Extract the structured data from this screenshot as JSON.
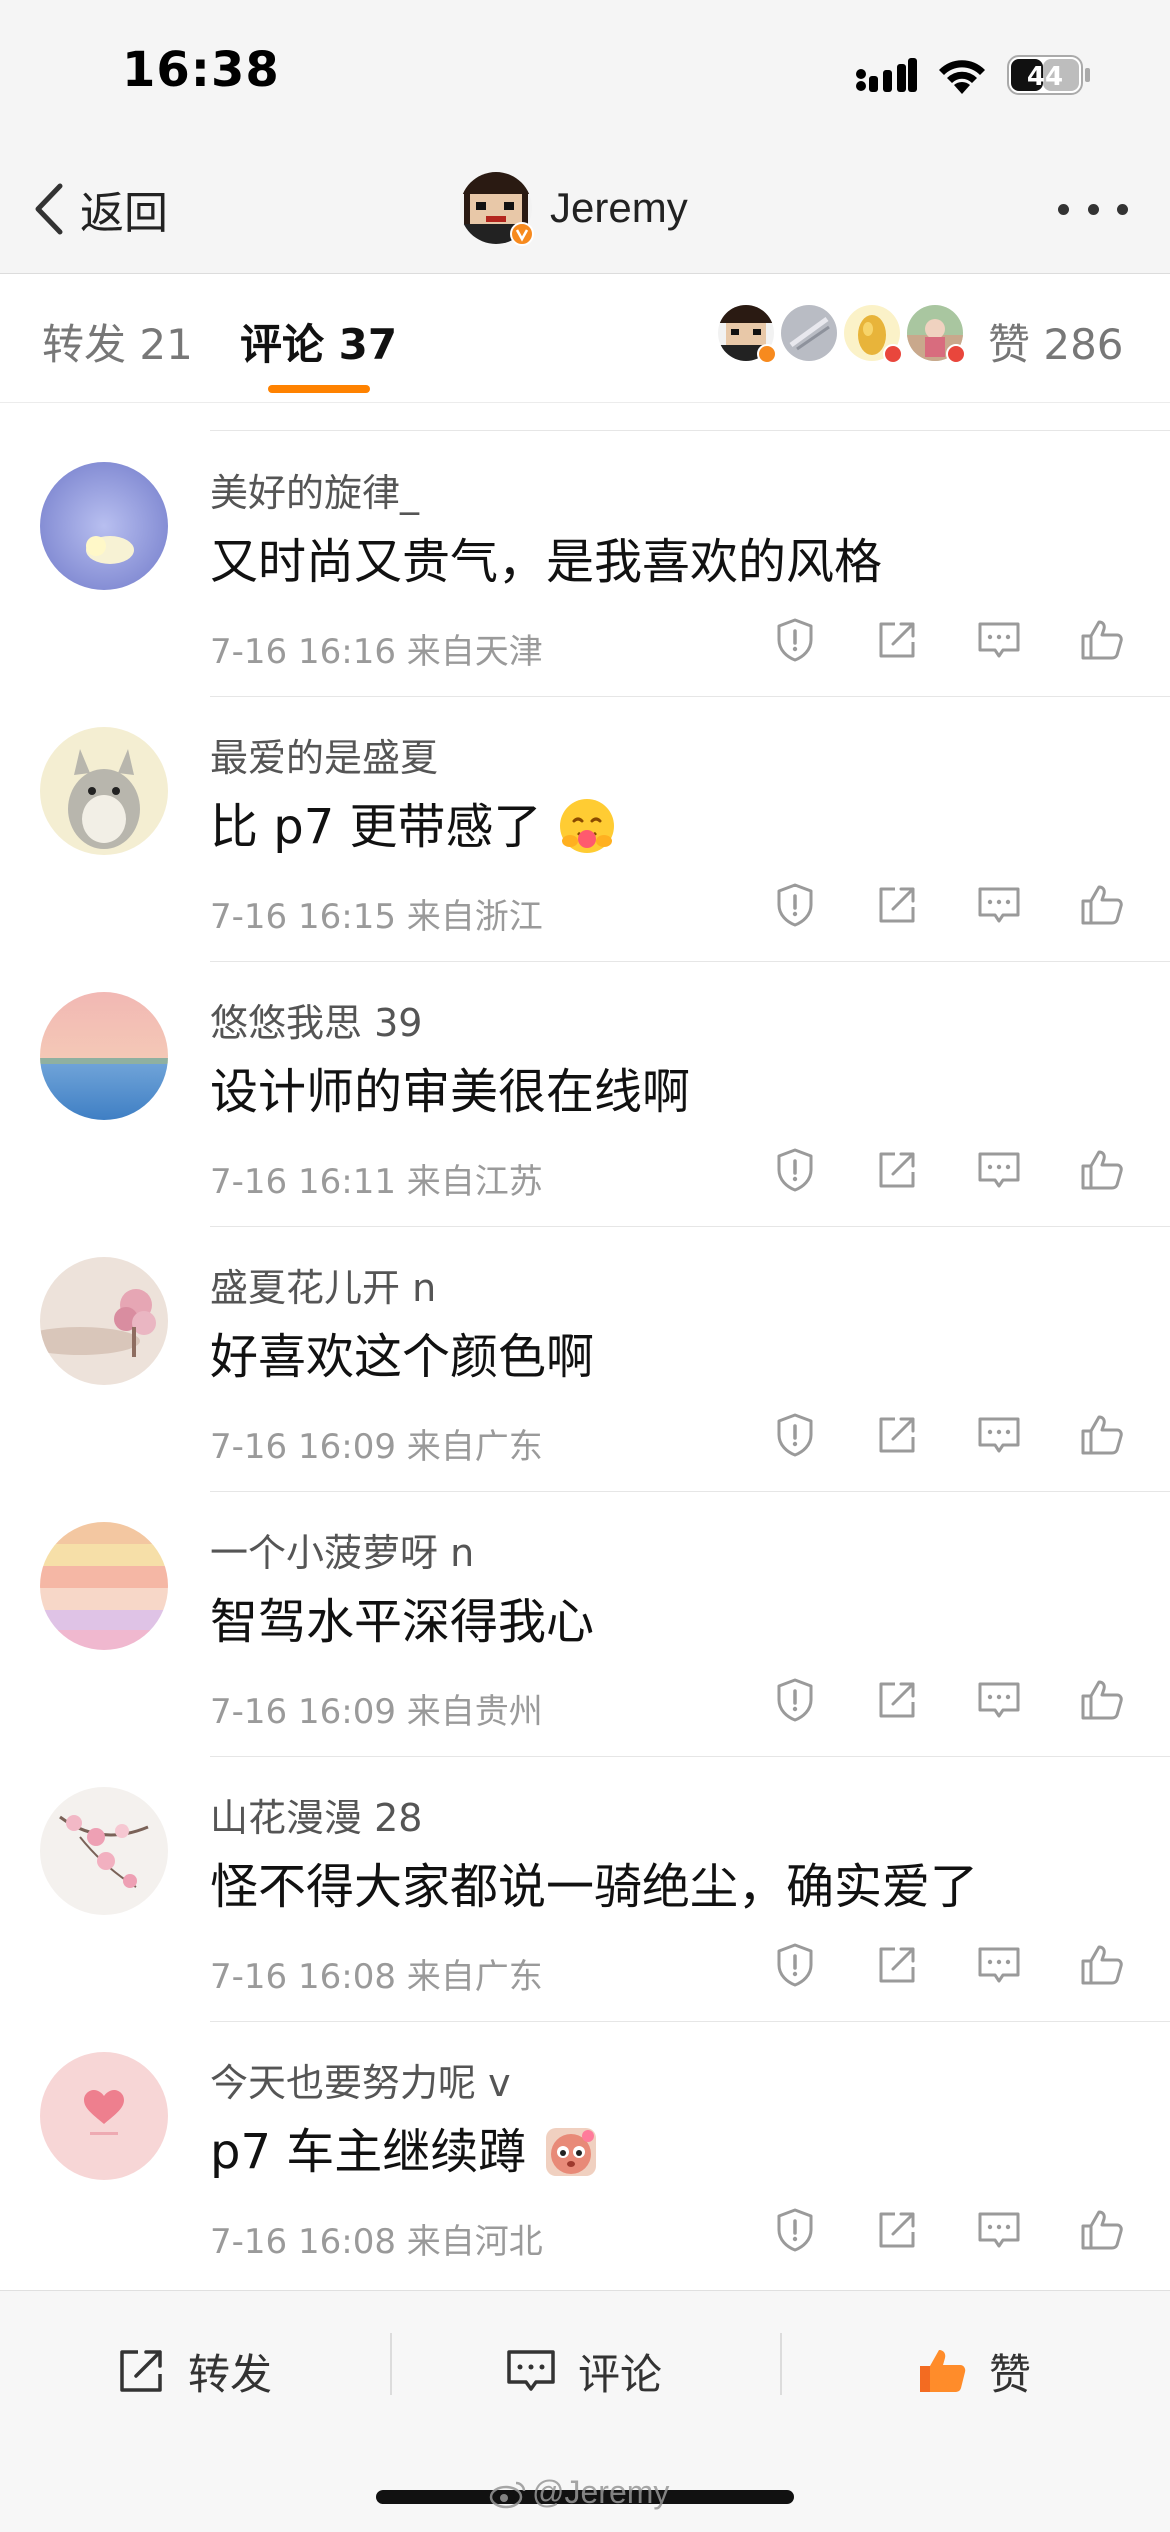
{
  "status_bar": {
    "time": "16:38",
    "battery": "44"
  },
  "nav": {
    "back_label": "返回",
    "author": "Jeremy"
  },
  "tabs": {
    "repost_label": "转发 21",
    "comment_label": "评论 37",
    "likes_label": "赞 286"
  },
  "comments": [
    {
      "user": "美好的旋律_",
      "text": "又时尚又贵气，是我喜欢的风格",
      "meta": "7-16 16:16  来自天津"
    },
    {
      "user": "最爱的是盛夏",
      "text": "比 p7 更带感了",
      "meta": "7-16 16:15  来自浙江"
    },
    {
      "user": "悠悠我思 39",
      "text": "设计师的审美很在线啊",
      "meta": "7-16 16:11  来自江苏"
    },
    {
      "user": "盛夏花儿开 n",
      "text": "好喜欢这个颜色啊",
      "meta": "7-16 16:09  来自广东"
    },
    {
      "user": "一个小菠萝呀 n",
      "text": "智驾水平深得我心",
      "meta": "7-16 16:09  来自贵州"
    },
    {
      "user": "山花漫漫 28",
      "text": "怪不得大家都说一骑绝尘，确实爱了",
      "meta": "7-16 16:08  来自广东"
    },
    {
      "user": "今天也要努力呢 v",
      "text": "p7 车主继续蹲",
      "meta": "7-16 16:08  来自河北"
    }
  ],
  "bottom_bar": {
    "repost_label": "转发",
    "comment_label": "评论",
    "like_label": "赞"
  },
  "watermark": "@Jeremy",
  "colors": {
    "accent": "#ff8200",
    "meta_text": "#9a9a9a",
    "background": "#f5f5f5"
  }
}
